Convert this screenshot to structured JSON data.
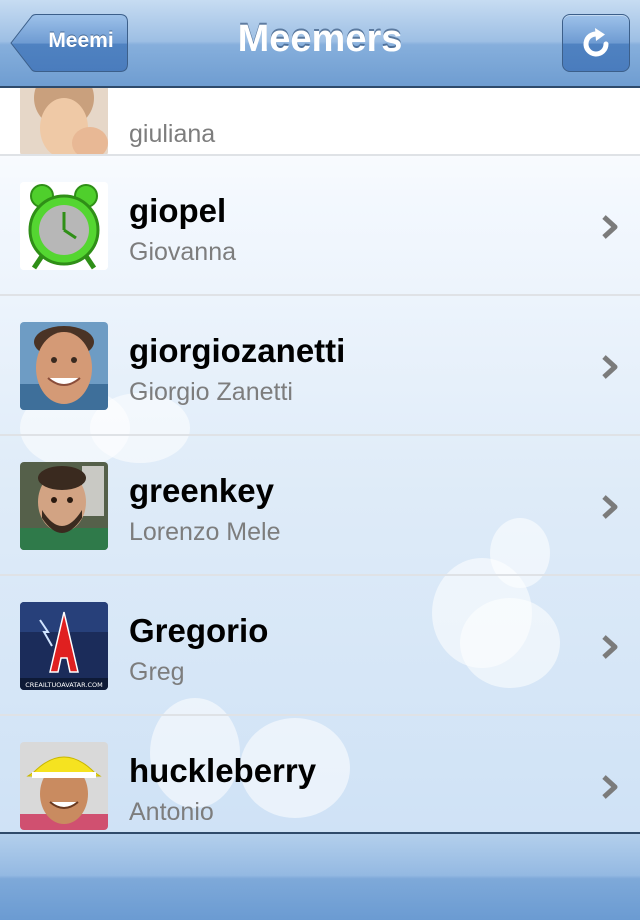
{
  "navbar": {
    "title": "Meemers",
    "back_label": "Meemi",
    "refresh_icon": "refresh-icon"
  },
  "list": {
    "items": [
      {
        "username": "",
        "realname": "giuliana",
        "avatar": "avatar-woman"
      },
      {
        "username": "giopel",
        "realname": "Giovanna",
        "avatar": "avatar-alarm-clock"
      },
      {
        "username": "giorgiozanetti",
        "realname": "Giorgio Zanetti",
        "avatar": "avatar-man-smiling"
      },
      {
        "username": "greenkey",
        "realname": "Lorenzo Mele",
        "avatar": "avatar-bearded-man"
      },
      {
        "username": "Gregorio",
        "realname": "Greg",
        "avatar": "avatar-letter-a"
      },
      {
        "username": "huckleberry",
        "realname": "Antonio",
        "avatar": "avatar-yellow-cap"
      }
    ],
    "avatar_badge": "CREAILTUOAVATAR.COM"
  },
  "colors": {
    "navbar": "#86afdc",
    "username": "#000000",
    "realname": "#7d7d7d",
    "chevron": "#7b7b7b"
  }
}
